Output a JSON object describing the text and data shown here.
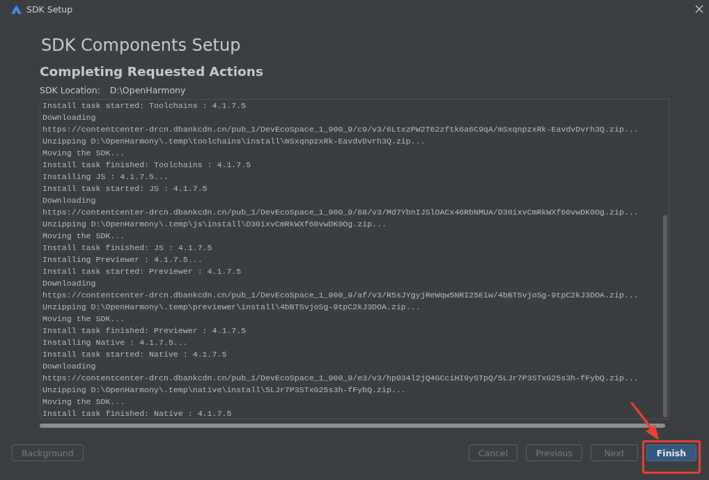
{
  "window": {
    "title": "SDK Setup"
  },
  "heading": "SDK Components Setup",
  "subheading": "Completing Requested Actions",
  "sdk_location": {
    "label": "SDK Location:",
    "value": "D:\\OpenHarmony"
  },
  "log_lines": [
    "Install task started: Toolchains : 4.1.7.5",
    "Downloading",
    "https://contentcenter-drcn.dbankcdn.cn/pub_1/DevEcoSpace_1_900_9/c9/v3/6LtxzPW2T62zftk6a6C9qA/mSxqnpzxRk-EavdvDvrh3Q.zip...",
    "Unzipping D:\\OpenHarmony\\.temp\\toolchains\\install\\mSxqnpzxRk-EavdvDvrh3Q.zip...",
    "Moving the SDK...",
    "Install task finished: Toolchains : 4.1.7.5",
    "Installing JS : 4.1.7.5...",
    "Install task started: JS : 4.1.7.5",
    "Downloading",
    "https://contentcenter-drcn.dbankcdn.cn/pub_1/DevEcoSpace_1_900_9/68/v3/Md7YbnIJSlOACx46RbNMUA/D30ixvCmRkWXf60vwDK0Og.zip...",
    "Unzipping D:\\OpenHarmony\\.temp\\js\\install\\D30ixvCmRkWXf60vwDK0Og.zip...",
    "Moving the SDK...",
    "Install task finished: JS : 4.1.7.5",
    "Installing Previewer : 4.1.7.5...",
    "Install task started: Previewer : 4.1.7.5",
    "Downloading",
    "https://contentcenter-drcn.dbankcdn.cn/pub_1/DevEcoSpace_1_900_9/af/v3/R5sJYgyjReWqw5NRI25Eiw/4bBTSvjoSg-9tpC2kJ3DOA.zip...",
    "Unzipping D:\\OpenHarmony\\.temp\\previewer\\install\\4bBTSvjoSg-9tpC2kJ3DOA.zip...",
    "Moving the SDK...",
    "Install task finished: Previewer : 4.1.7.5",
    "Installing Native : 4.1.7.5...",
    "Install task started: Native : 4.1.7.5",
    "Downloading",
    "https://contentcenter-drcn.dbankcdn.cn/pub_1/DevEcoSpace_1_900_9/e3/v3/hp034l2jQ4GCciHI9ySTpQ/5LJr7P3STxG25s3h-fFybQ.zip...",
    "Unzipping D:\\OpenHarmony\\.temp\\native\\install\\5LJr7P3STxG25s3h-fFybQ.zip...",
    "Moving the SDK...",
    "Install task finished: Native : 4.1.7.5"
  ],
  "buttons": [
    {
      "label": "Background",
      "kind": "normal",
      "disabled": true
    },
    {
      "label": "Cancel",
      "kind": "normal",
      "disabled": true
    },
    {
      "label": "Previous",
      "kind": "normal",
      "disabled": true
    },
    {
      "label": "Next",
      "kind": "normal",
      "disabled": true
    },
    {
      "label": "Finish",
      "kind": "primary",
      "disabled": false
    }
  ],
  "annotation": {
    "kind": "arrow_and_frame"
  }
}
